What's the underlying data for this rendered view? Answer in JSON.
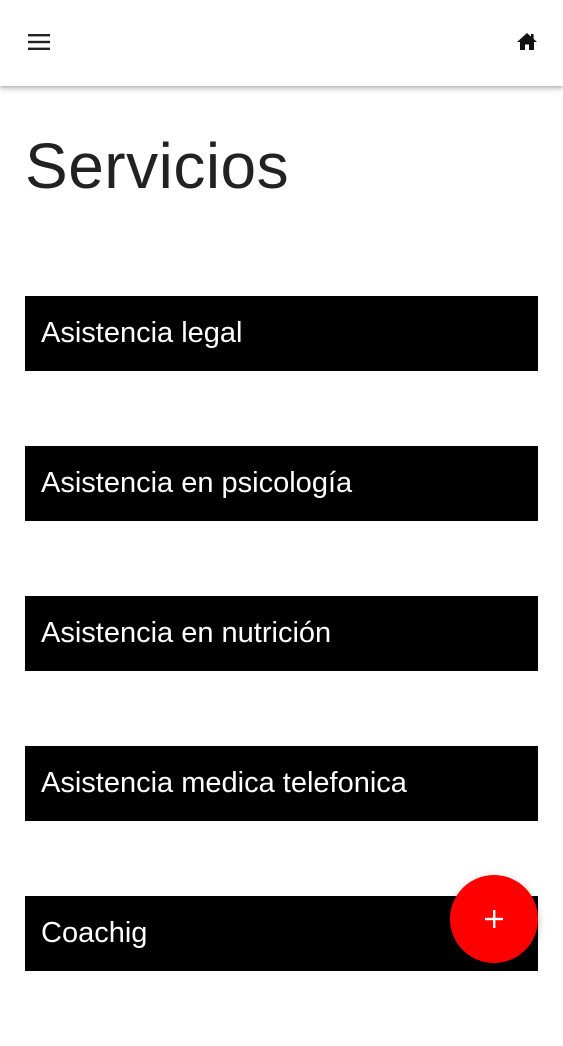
{
  "header": {
    "menu_icon": "hamburger-menu-icon",
    "home_icon": "home-icon"
  },
  "page": {
    "title": "Servicios"
  },
  "services": [
    {
      "label": "Asistencia legal"
    },
    {
      "label": "Asistencia en psicología"
    },
    {
      "label": "Asistencia en nutrición"
    },
    {
      "label": "Asistencia medica telefonica"
    },
    {
      "label": "Coachig"
    }
  ],
  "fab": {
    "icon": "plus-icon",
    "color": "#ff0000"
  },
  "colors": {
    "item_background": "#000000",
    "item_text": "#ffffff",
    "page_background": "#ffffff"
  }
}
